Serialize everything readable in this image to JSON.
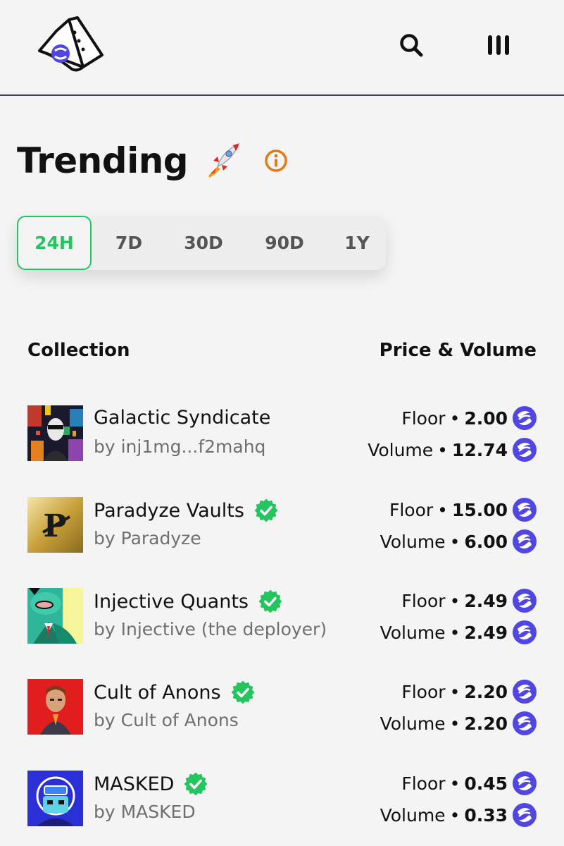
{
  "header": {
    "logo_icon": "helix-logo-icon",
    "search_icon": "search-icon",
    "menu_icon": "menu-icon"
  },
  "page": {
    "title": "Trending",
    "title_icon": "rocket-icon",
    "info_icon": "info-icon"
  },
  "tabs": [
    {
      "label": "24H",
      "active": true
    },
    {
      "label": "7D",
      "active": false
    },
    {
      "label": "30D",
      "active": false
    },
    {
      "label": "90D",
      "active": false
    },
    {
      "label": "1Y",
      "active": false
    }
  ],
  "table": {
    "col_collection": "Collection",
    "col_price_volume": "Price & Volume"
  },
  "stat_labels": {
    "floor": "Floor",
    "volume": "Volume",
    "separator": "•"
  },
  "collections": [
    {
      "name": "Galactic Syndicate",
      "by": "by inj1mg...f2mahq",
      "verified": false,
      "floor": "2.00",
      "volume": "12.74"
    },
    {
      "name": "Paradyze Vaults",
      "by": "by Paradyze",
      "verified": true,
      "floor": "15.00",
      "volume": "6.00"
    },
    {
      "name": "Injective Quants",
      "by": "by Injective (the deployer)",
      "verified": true,
      "floor": "2.49",
      "volume": "2.49"
    },
    {
      "name": "Cult of Anons",
      "by": "by Cult of Anons",
      "verified": true,
      "floor": "2.20",
      "volume": "2.20"
    },
    {
      "name": "MASKED",
      "by": "by MASKED",
      "verified": true,
      "floor": "0.45",
      "volume": "0.33"
    }
  ],
  "colors": {
    "accent_green": "#22c55e",
    "info_orange": "#e07b1a",
    "token_blue": "#4f46e5"
  }
}
